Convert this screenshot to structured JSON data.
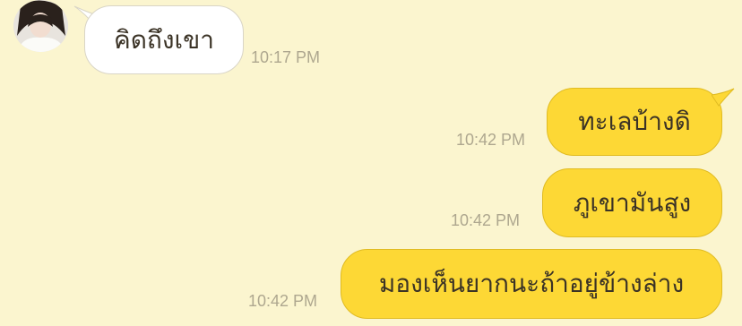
{
  "messages": [
    {
      "text": "คิดถึงเขา",
      "time": "10:17 PM",
      "direction": "incoming"
    },
    {
      "text": "ทะเลบ้างดิ",
      "time": "10:42 PM",
      "direction": "outgoing"
    },
    {
      "text": "ภูเขามันสูง",
      "time": "10:42 PM",
      "direction": "outgoing"
    },
    {
      "text": "มองเห็นยากนะถ้าอยู่ข้างล่าง",
      "time": "10:42 PM",
      "direction": "outgoing"
    }
  ],
  "colors": {
    "background": "#fbf5cf",
    "outgoing_bubble": "#fdd835",
    "incoming_bubble": "#ffffff",
    "timestamp": "#aea78f"
  },
  "avatar_icon": "contact-avatar-photo"
}
